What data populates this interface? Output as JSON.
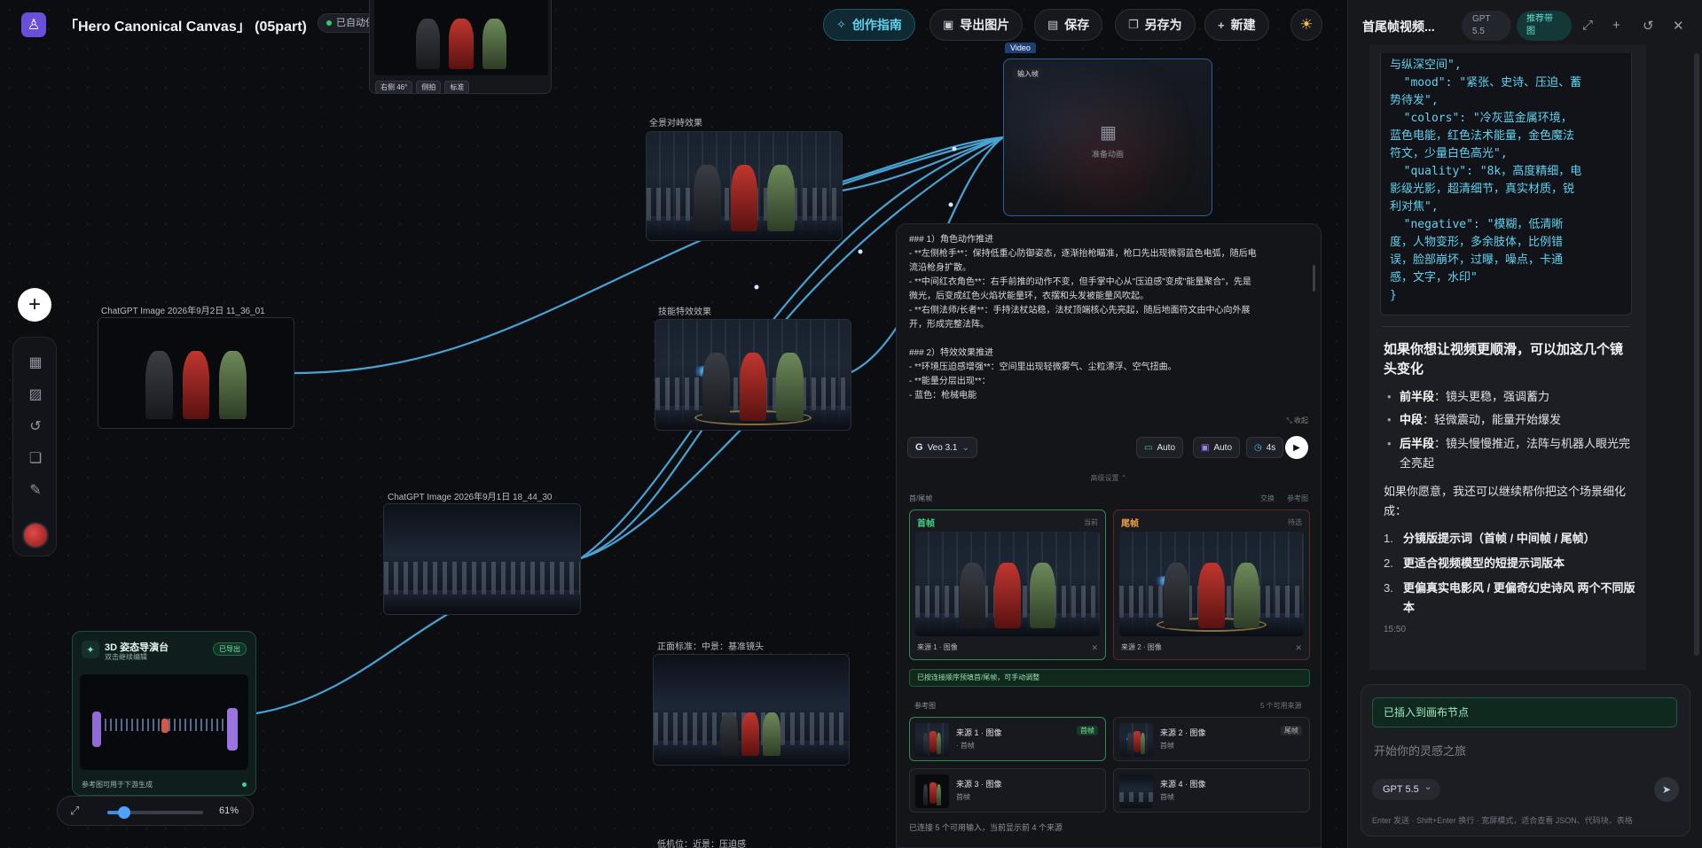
{
  "header": {
    "logo": "♙",
    "doc_title": "「Hero Canonical Canvas」 (05part)",
    "autosave": "已自动保存",
    "buttons": {
      "guide": "创作指南",
      "export": "导出图片",
      "save": "保存",
      "save_as": "另存为",
      "new": "新建"
    }
  },
  "left_toolbar": {
    "add": "+",
    "icons": [
      "grid-icon",
      "image-icon",
      "history-icon",
      "book-icon",
      "wrench-icon"
    ]
  },
  "nodes": {
    "top_partial": {
      "tags": [
        "右侧 46°",
        "侧拍",
        "标准"
      ]
    },
    "panorama": {
      "label": "全景对峙效果"
    },
    "skill_fx": {
      "label": "技能特效效果"
    },
    "chatgpt_a": {
      "label": "ChatGPT Image 2026年9月2日 11_36_01"
    },
    "chatgpt_b": {
      "label": "ChatGPT Image 2026年9月1日 18_44_30"
    },
    "front": {
      "label": "正面标准：中景：基准镜头"
    },
    "low_angle": {
      "label": "低机位：近景：压迫感"
    },
    "stage": {
      "icon": "✦",
      "title": "3D 姿态导演台",
      "subtitle": "双击继续编辑",
      "badge": "已导出",
      "footer": "参考图可用于下游生成"
    },
    "video": {
      "tag": "Video",
      "input_frame": "输入帧",
      "placeholder": "准备动画"
    }
  },
  "zoom": {
    "value_label": "61%",
    "percent": 61
  },
  "generation": {
    "prompt_lines": [
      "### 1）角色动作推进",
      "- **左侧枪手**：保持低重心防御姿态，逐渐抬枪瞄准，枪口先出现微弱蓝色电弧，随后电",
      "流沿枪身扩散。",
      "- **中间红衣角色**：右手前推的动作不变，但手掌中心从\"压迫感\"变成\"能量聚合\"，先是",
      "微光，后变成红色火焰状能量环，衣摆和头发被能量风吹起。",
      "- **右侧法师/长者**：手持法杖站稳，法杖顶端核心先亮起，随后地面符文由中心向外展",
      "开，形成完整法阵。",
      "",
      "### 2）特效效果推进",
      "- **环境压迫感增强**：空间里出现轻微雾气、尘粒漂浮、空气扭曲。",
      "- **能量分层出现**：",
      "  - 蓝色：枪械电能"
    ],
    "collapse": "收起",
    "model": "Veo 3.1",
    "ratio": "Auto",
    "quality": "Auto",
    "duration": "4s",
    "advanced": "高级设置 ⌃",
    "section_frames": "首/尾帧",
    "swap": "交换",
    "reference_img": "参考图",
    "first": {
      "title": "首帧",
      "status": "当前",
      "source": "来源 1 · 图像"
    },
    "last": {
      "title": "尾帧",
      "status": "待选",
      "source": "来源 2 · 图像"
    },
    "notice": "已按连接顺序预填首/尾帧，可手动调整",
    "refs_title": "参考图",
    "refs_count": "5 个可用来源",
    "refs": [
      {
        "name": "来源 1 · 图像",
        "sub": "首帧",
        "badge": "首帧"
      },
      {
        "name": "来源 2 · 图像",
        "sub": "首帧",
        "badge": "尾帧"
      },
      {
        "name": "来源 3 · 图像",
        "sub": "首帧",
        "badge": ""
      },
      {
        "name": "来源 4 · 图像",
        "sub": "首帧",
        "badge": ""
      }
    ],
    "footer": "已连接 5 个可用输入，当前显示前 4 个来源"
  },
  "chat": {
    "title": "首尾帧视频...",
    "model_pill": "GPT\n5.5",
    "rec_pill": "推荐带\n图",
    "code_text": "与纵深空间\",\n  \"mood\": \"紧张、史诗、压迫、蓄\n势待发\",\n  \"colors\": \"冷灰蓝金属环境，\n蓝色电能，红色法术能量，金色魔法\n符文，少量白色高光\",\n  \"quality\": \"8k，高度精细，电\n影级光影，超清细节，真实材质，锐\n利对焦\",\n  \"negative\": \"模糊，低清晰\n度，人物变形，多余肢体，比例错\n误，脸部崩坏，过曝，噪点，卡通\n感，文字，水印\"\n}",
    "heading": "如果你想让视频更顺滑，可以加这几个镜头变化",
    "bullets": [
      {
        "k": "前半段",
        "v": "：镜头更稳，强调蓄力"
      },
      {
        "k": "中段",
        "v": "：轻微震动，能量开始爆发"
      },
      {
        "k": "后半段",
        "v": "：镜头慢慢推近，法阵与机器人眼光完全亮起"
      }
    ],
    "para": "如果你愿意，我还可以继续帮你把这个场景细化成：",
    "options": [
      "分镜版提示词（首帧 / 中间帧 / 尾帧）",
      "更适合视频模型的短提示词版本",
      "更偏真实电影风 / 更偏奇幻史诗风 两个不同版本"
    ],
    "timestamp": "15:50",
    "inserted": "已插入到画布节点",
    "placeholder": "开始你的灵感之旅",
    "model_select": "GPT 5.5",
    "hint": "Enter 发送 · Shift+Enter 换行 · 宽屏模式，适合查看 JSON、代码块、表格"
  },
  "colors": {
    "accent_cyan": "#5fd3f0",
    "wire": "#4fb3e8",
    "ok_green": "#3fd17f",
    "warn_orange": "#f0a040"
  }
}
